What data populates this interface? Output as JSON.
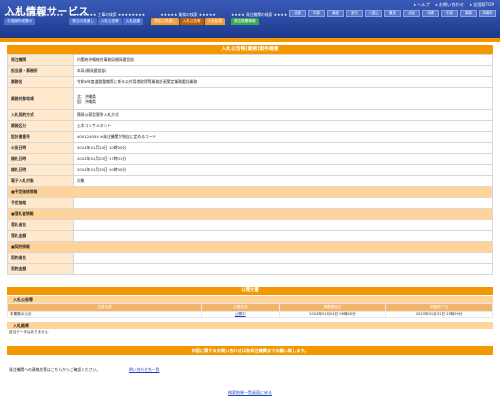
{
  "header": {
    "title": "入札情報サービス",
    "links": [
      "ヘルプ",
      "お問い合わせ",
      "全国版TOP"
    ],
    "regions": [
      "北部",
      "中部",
      "南部",
      "宮古",
      "八重山",
      "離島",
      "北谷",
      "沖縄",
      "中部",
      "南部",
      "沖縄市"
    ]
  },
  "nav": {
    "groups": [
      {
        "title": "★★★★★ 平成線の検索 ★★★★★",
        "color": "blue",
        "tabs": [
          "平成線作成業の"
        ]
      },
      {
        "title": "★★★★★★★★ 工事の検索 ★★★★★★★★",
        "color": "blue",
        "tabs": [
          "発注の見通し",
          "入札公告等",
          "入札結果"
        ]
      },
      {
        "title": "★★★★★ 業務の検索 ★★★★★",
        "color": "orange",
        "tabs": [
          "発注の見通し",
          "入札公告等",
          "入札結果"
        ],
        "current": 1
      },
      {
        "title": "★★★★ 発注機関の検索 ★★★★",
        "color": "green",
        "tabs": [
          "発注機関情報"
        ]
      }
    ]
  },
  "main": {
    "title": "入札公告等(業務)案件概要",
    "rows": [
      {
        "label": "発注機関",
        "value": "内閣府沖縄総合事務局開発建設部"
      },
      {
        "label": "担当部・事務所",
        "value": "本局(開発建設部)"
      },
      {
        "label": "業務名",
        "value": "令和6年度道路整備等に係る公共用地取得等業務計画策定業務委託業務"
      },
      {
        "label": "業務対象地域",
        "value": "北：沖縄県",
        "value2": "国：沖縄県",
        "tall": true
      },
      {
        "label": "入札契約方式",
        "value": "簡易公募型競争入札方式"
      },
      {
        "label": "業務区分",
        "value": "土木コンサルタント"
      },
      {
        "label": "設計書番号",
        "value": "400124054     ※発注機関が独自に定めるコード"
      },
      {
        "label": "公告日時",
        "value": "2024年01月24日 10時00分"
      },
      {
        "label": "開札日時",
        "value": "2024年01月03日 17時01分"
      },
      {
        "label": "開札日時",
        "value": "2024年01月25日 10時00分"
      },
      {
        "label": "電子入札対象",
        "value": "対象"
      },
      {
        "label": "■予定価格情報",
        "section": true
      },
      {
        "label": "予定価格",
        "value": ""
      },
      {
        "label": "■落札者情報",
        "section": true
      },
      {
        "label": "落札者名",
        "value": ""
      },
      {
        "label": "落札金額",
        "value": ""
      },
      {
        "label": "■契約情報",
        "section": true
      },
      {
        "label": "契約者名",
        "value": ""
      },
      {
        "label": "契約金額",
        "value": ""
      }
    ]
  },
  "documents": {
    "title": "公開文書",
    "subtitle": "入札公告等",
    "headers": [
      "文書名称",
      "公開状況",
      "掲載開始日",
      "掲載終了日"
    ],
    "rows": [
      {
        "name": "本業務の公示",
        "status": "公開中",
        "start": "2024年01月24日 09時00分",
        "end": "2025年01月31日 23時59分"
      }
    ]
  },
  "results": {
    "title": "入札結果",
    "none": "該当データはありません"
  },
  "contact": {
    "bar": "内容に関するお問い合わせは各発注機関までお願い致します。",
    "text": "発注機関への連絡先等はこちらからご確認ください。",
    "link": "問い合わせ先一覧"
  },
  "back": "検索結果一覧画面に戻る"
}
